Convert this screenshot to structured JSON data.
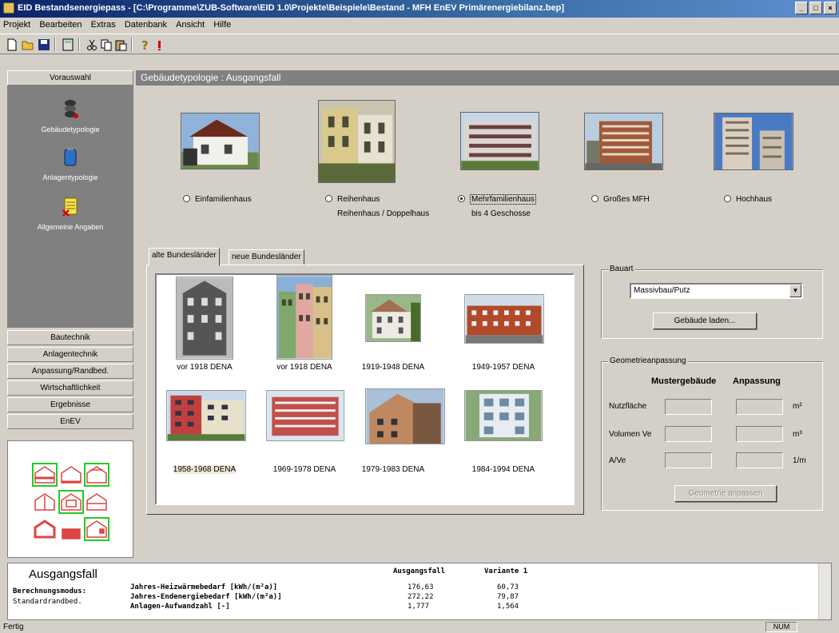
{
  "window": {
    "title": "EID Bestandsenergiepass - [C:\\Programme\\ZUB-Software\\EID 1.0\\Projekte\\Beispiele\\Bestand - MFH EnEV Primärenergiebilanz.bep]"
  },
  "menu": [
    "Projekt",
    "Bearbeiten",
    "Extras",
    "Datenbank",
    "Ansicht",
    "Hilfe"
  ],
  "toolbar_icons": [
    "new-icon",
    "open-icon",
    "save-icon",
    "calculator-icon",
    "cut-icon",
    "copy-icon",
    "paste-icon",
    "help-icon",
    "run-icon"
  ],
  "left": {
    "vorauswahl": "Vorauswahl",
    "nav": [
      {
        "label": "Gebäudetypologie",
        "icon": "building-typology-icon"
      },
      {
        "label": "Anlagentypologie",
        "icon": "system-typology-icon"
      },
      {
        "label": "Allgemeine Angaben",
        "icon": "general-data-icon"
      }
    ],
    "buttons": [
      "Bautechnik",
      "Anlagentechnik",
      "Anpassung/Randbed.",
      "Wirtschaftlichkeit",
      "Ergebnisse",
      "EnEV"
    ]
  },
  "main": {
    "header": "Gebäudetypologie : Ausgangsfall",
    "types": [
      {
        "line1": "Einfamilienhaus",
        "line2": "",
        "selected": false
      },
      {
        "line1": "Reihenhaus",
        "line2": "Reihenhaus / Doppelhaus",
        "selected": false
      },
      {
        "line1": "Mehrfamilienhaus",
        "line2": "bis 4 Geschosse",
        "selected": true
      },
      {
        "line1": "Großes MFH",
        "line2": "",
        "selected": false
      },
      {
        "line1": "Hochhaus",
        "line2": "",
        "selected": false
      }
    ],
    "tabs": [
      "alte Bundesländer",
      "neue Bundesländer"
    ],
    "photos": [
      "vor 1918 DENA",
      "vor 1918 DENA",
      "1919-1948 DENA",
      "1949-1957 DENA",
      "1958-1968 DENA",
      "1969-1978 DENA",
      "1979-1983 DENA",
      "1984-1994 DENA"
    ],
    "bauart": {
      "legend": "Bauart",
      "value": "Massivbau/Putz",
      "load_button": "Gebäude laden..."
    },
    "geometrie": {
      "legend": "Geometrieanpassung",
      "col1": "Mustergebäude",
      "col2": "Anpassung",
      "rows": [
        {
          "label": "Nutzfläche",
          "unit": "m²"
        },
        {
          "label": "Volumen Ve",
          "unit": "m³"
        },
        {
          "label": "A/Ve",
          "unit": "1/m"
        }
      ],
      "button": "Geometrie anpassen"
    }
  },
  "summary": {
    "title": "Ausgangsfall",
    "mode_label": "Berechnungsmodus:",
    "mode_value": "Standardrandbed.",
    "col1": "Ausgangsfall",
    "col2": "Variante 1",
    "rows": [
      {
        "label": "Jahres-Heizwärmebedarf [kWh/(m²a)]",
        "v1": "176,63",
        "v2": "60,73"
      },
      {
        "label": "Jahres-Endenergiebedarf [kWh/(m²a)]",
        "v1": "272,22",
        "v2": "79,87"
      },
      {
        "label": "Anlagen-Aufwandzahl [-]",
        "v1": "1,777",
        "v2": "1,564"
      }
    ]
  },
  "status": {
    "left": "Fertig",
    "right": "NUM"
  }
}
